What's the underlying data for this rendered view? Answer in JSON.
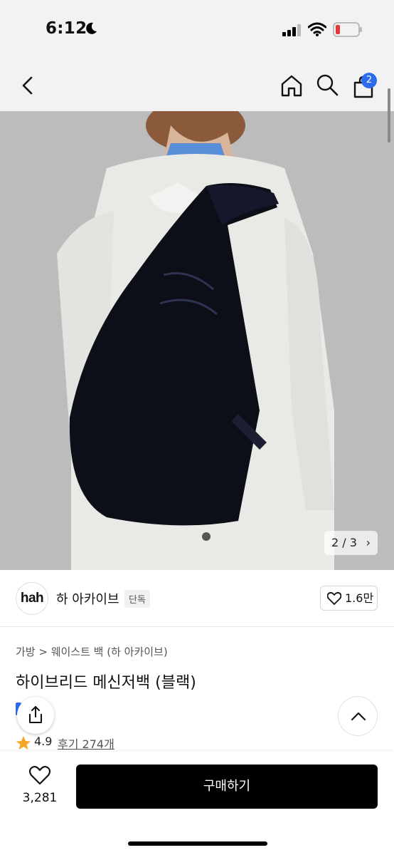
{
  "status_bar": {
    "time": "6:12",
    "icons": [
      "moon-icon",
      "signal-icon",
      "wifi-icon",
      "battery-icon"
    ]
  },
  "nav": {
    "icons": [
      "back-icon",
      "home-icon",
      "search-icon",
      "cart-icon"
    ],
    "cart_badge": "2"
  },
  "gallery": {
    "pager": "2 / 3",
    "pager_arrow": "›"
  },
  "brand": {
    "logo_text": "hah",
    "name": "하 아카이브",
    "tag": "단독",
    "like_count": "1.6만"
  },
  "product": {
    "breadcrumb": "가방 > 웨이스트 백 (하 아카이브)",
    "title": "하이브리드 메신저백 (블랙)",
    "rating": "4.9",
    "reviews": "후기 274개"
  },
  "bottom": {
    "wish_count": "3,281",
    "buy_label": "구매하기"
  },
  "colors": {
    "accent": "#2b6cf0",
    "buy_button": "#000000",
    "star": "#f5a623"
  }
}
